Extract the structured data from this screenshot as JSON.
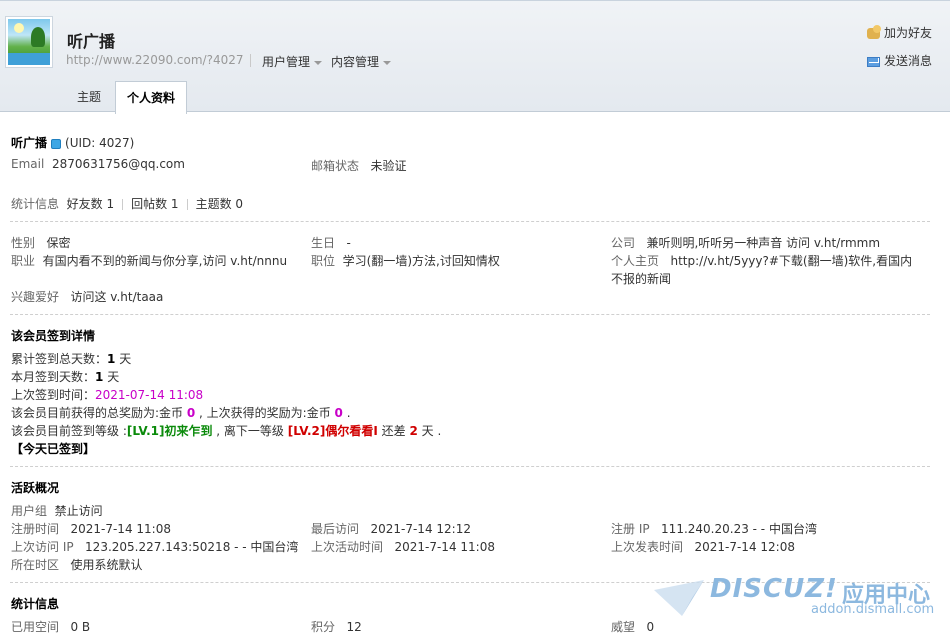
{
  "header": {
    "username": "听广播",
    "url": "http://www.22090.com/?4027",
    "menus": [
      {
        "label": "用户管理"
      },
      {
        "label": "内容管理"
      }
    ],
    "actions": {
      "add_friend": "加为好友",
      "send_message": "发送消息"
    },
    "tabs": [
      {
        "label": "主题"
      },
      {
        "label": "个人资料"
      }
    ]
  },
  "profile": {
    "name": "听广播",
    "uid": "(UID: 4027)",
    "email_label": "Email",
    "email": "2870631756@qq.com",
    "email_status_label": "邮箱状态",
    "email_status": "未验证",
    "stats_label": "统计信息",
    "friends": "好友数 1",
    "replies": "回帖数 1",
    "topics": "主题数 0",
    "gender_label": "性别",
    "gender": "保密",
    "birthday_label": "生日",
    "birthday": "-",
    "company_label": "公司",
    "company": "兼听则明,听听另一种声音 访问 v.ht/rmmm",
    "job_label": "职业",
    "job": "有国内看不到的新闻与你分享,访问 v.ht/nnnu",
    "position_label": "职位",
    "position": "学习(翻一墙)方法,讨回知情权",
    "homepage_label": "个人主页",
    "homepage_line1": "http://v.ht/5yyy?#下载(翻一墙)软件,看国内",
    "homepage_line2": "不报的新闻",
    "hobby_label": "兴趣爱好",
    "hobby": "访问这 v.ht/taaa"
  },
  "signin": {
    "title": "该会员签到详情",
    "total_prefix": "累计签到总天数：",
    "total_value": "1",
    "day_unit": " 天",
    "month_prefix": "本月签到天数：",
    "month_value": "1",
    "last_prefix": "上次签到时间：",
    "last_value": "2021-07-14 11:08",
    "reward_prefix": "该会员目前获得的总奖励为:金币 ",
    "reward_total": "0",
    "reward_mid": " , 上次获得的奖励为:金币 ",
    "reward_last": "0",
    "reward_end": " .",
    "level_prefix": "该会员目前签到等级 :",
    "level_current": "[LV.1]初来乍到",
    "level_mid": " , 离下一等级 ",
    "level_next": "[LV.2]偶尔看看I",
    "level_gap_prefix": " 还差 ",
    "level_gap": "2",
    "level_gap_suffix": " 天 .",
    "today": "【今天已签到】"
  },
  "activity": {
    "title": "活跃概况",
    "group_label": "用户组",
    "group": "禁止访问",
    "reg_time_label": "注册时间",
    "reg_time": "2021-7-14 11:08",
    "last_visit_label": "最后访问",
    "last_visit": "2021-7-14 12:12",
    "reg_ip_label": "注册 IP",
    "reg_ip": "111.240.20.23 - - 中国台湾",
    "last_ip_label": "上次访问 IP",
    "last_ip": "123.205.227.143:50218 - - 中国台湾",
    "last_active_label": "上次活动时间",
    "last_active": "2021-7-14 11:08",
    "last_post_label": "上次发表时间",
    "last_post": "2021-7-14 12:08",
    "tz_label": "所在时区",
    "tz": "使用系统默认"
  },
  "stats": {
    "title": "统计信息",
    "space_label": "已用空间",
    "space": "0 B",
    "points_label": "积分",
    "points": "12",
    "prestige_label": "威望",
    "prestige": "0"
  },
  "watermark": {
    "brand": "DISCUZ!",
    "brand_cn": "应用中心",
    "url": "addon.dismall.com"
  }
}
